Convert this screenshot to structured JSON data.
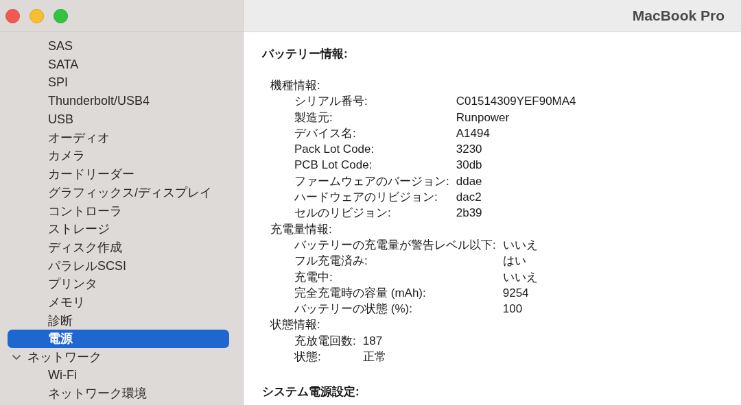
{
  "window": {
    "title": "MacBook Pro"
  },
  "sidebar": {
    "items": [
      {
        "label": "SAS",
        "selected": false
      },
      {
        "label": "SATA",
        "selected": false
      },
      {
        "label": "SPI",
        "selected": false
      },
      {
        "label": "Thunderbolt/USB4",
        "selected": false
      },
      {
        "label": "USB",
        "selected": false
      },
      {
        "label": "オーディオ",
        "selected": false
      },
      {
        "label": "カメラ",
        "selected": false
      },
      {
        "label": "カードリーダー",
        "selected": false
      },
      {
        "label": "グラフィックス/ディスプレイ",
        "selected": false
      },
      {
        "label": "コントローラ",
        "selected": false
      },
      {
        "label": "ストレージ",
        "selected": false
      },
      {
        "label": "ディスク作成",
        "selected": false
      },
      {
        "label": "パラレルSCSI",
        "selected": false
      },
      {
        "label": "プリンタ",
        "selected": false
      },
      {
        "label": "メモリ",
        "selected": false
      },
      {
        "label": "診断",
        "selected": false
      },
      {
        "label": "電源",
        "selected": true
      },
      {
        "label": "ネットワーク",
        "selected": false,
        "expanded": true,
        "children": [
          {
            "label": "Wi-Fi",
            "selected": false
          },
          {
            "label": "ネットワーク環境",
            "selected": false
          }
        ]
      }
    ]
  },
  "content": {
    "sections": [
      {
        "title": "バッテリー情報:",
        "groups": [
          {
            "title": "機種情報:",
            "rows": [
              {
                "label": "シリアル番号:",
                "value": "C01514309YEF90MA4"
              },
              {
                "label": "製造元:",
                "value": "Runpower"
              },
              {
                "label": "デバイス名:",
                "value": "A1494"
              },
              {
                "label": "Pack Lot Code:",
                "value": "3230"
              },
              {
                "label": "PCB Lot Code:",
                "value": "30db"
              },
              {
                "label": "ファームウェアのバージョン:",
                "value": "ddae"
              },
              {
                "label": "ハードウェアのリビジョン:",
                "value": "dac2"
              },
              {
                "label": "セルのリビジョン:",
                "value": "2b39"
              }
            ]
          },
          {
            "title": "充電量情報:",
            "rows": [
              {
                "label": "バッテリーの充電量が警告レベル以下:",
                "value": "いいえ"
              },
              {
                "label": "フル充電済み:",
                "value": "はい"
              },
              {
                "label": "充電中:",
                "value": "いいえ"
              },
              {
                "label": "完全充電時の容量 (mAh):",
                "value": "9254"
              },
              {
                "label": "バッテリーの状態 (%):",
                "value": "100"
              }
            ]
          },
          {
            "title": "状態情報:",
            "rows": [
              {
                "label": "充放電回数:",
                "value": "187"
              },
              {
                "label": "状態:",
                "value": "正常"
              }
            ]
          }
        ]
      },
      {
        "title": "システム電源設定:"
      }
    ]
  }
}
